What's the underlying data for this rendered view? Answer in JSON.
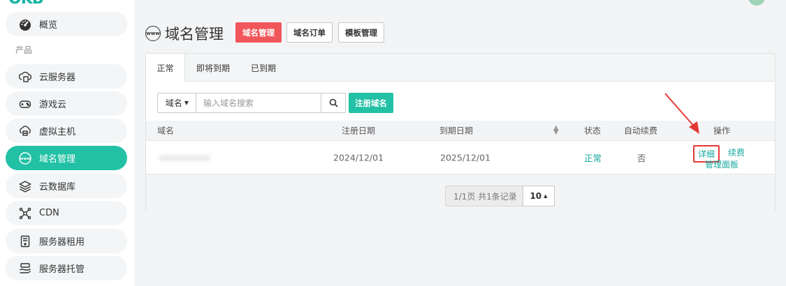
{
  "sidebar": {
    "section_label": "产品",
    "items": [
      {
        "label": "概览",
        "icon": "dashboard-icon"
      },
      {
        "label": "云服务器",
        "icon": "cloud-server-icon"
      },
      {
        "label": "游戏云",
        "icon": "gamepad-icon"
      },
      {
        "label": "虚拟主机",
        "icon": "virtual-host-icon"
      },
      {
        "label": "域名管理",
        "icon": "www-icon"
      },
      {
        "label": "云数据库",
        "icon": "database-layers-icon"
      },
      {
        "label": "CDN",
        "icon": "cdn-icon"
      },
      {
        "label": "服务器租用",
        "icon": "server-rent-icon"
      },
      {
        "label": "服务器托管",
        "icon": "server-hosting-icon"
      }
    ]
  },
  "header": {
    "title": "域名管理",
    "buttons": [
      "域名管理",
      "域名订单",
      "模板管理"
    ]
  },
  "tabs": [
    "正常",
    "即将到期",
    "已到期"
  ],
  "filter": {
    "select_value": "域名",
    "search_placeholder": "输入域名搜索",
    "register_button": "注册域名"
  },
  "table": {
    "columns": [
      "域名",
      "注册日期",
      "到期日期",
      "状态",
      "自动续费",
      "操作"
    ],
    "rows": [
      {
        "domain": "",
        "reg_date": "2024/12/01",
        "exp_date": "2025/12/01",
        "status": "正常",
        "auto_renew": "否",
        "actions": [
          "详细",
          "续费",
          "管理面板"
        ]
      }
    ]
  },
  "pager": {
    "info": "1/1页 共1条记录",
    "page_size": "10"
  },
  "colors": {
    "accent": "#22c1a5",
    "danger": "#f1565b",
    "link": "#16a8a0",
    "highlight": "#e53935"
  }
}
